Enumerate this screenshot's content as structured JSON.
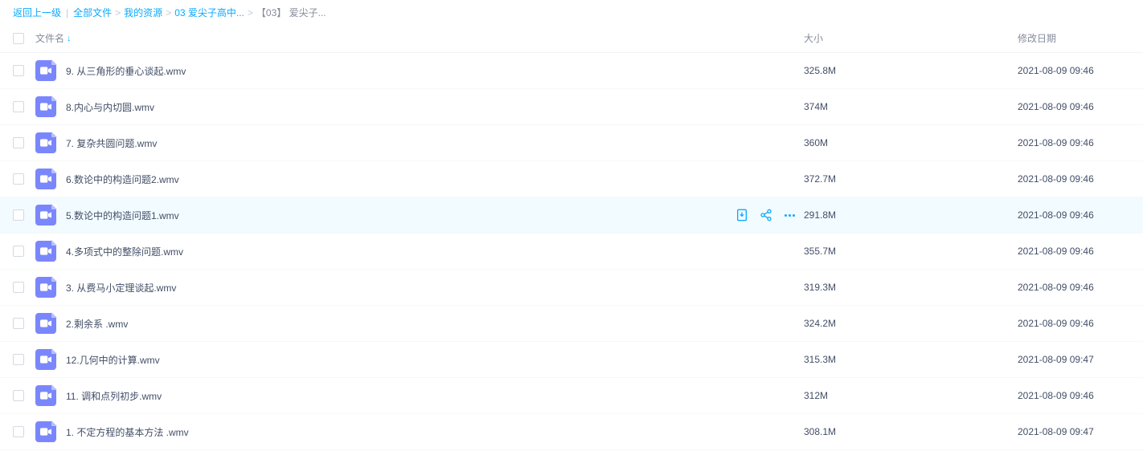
{
  "breadcrumb": {
    "back": "返回上一级",
    "items": [
      {
        "label": "全部文件",
        "link": true
      },
      {
        "label": "我的资源",
        "link": true
      },
      {
        "label": "03 爱尖子高中...",
        "link": true
      },
      {
        "label": "【03】 爱尖子...",
        "link": false
      }
    ]
  },
  "columns": {
    "name": "文件名",
    "size": "大小",
    "date": "修改日期"
  },
  "files": [
    {
      "name": "9. 从三角形的垂心谈起.wmv",
      "size": "325.8M",
      "date": "2021-08-09 09:46",
      "hover": false
    },
    {
      "name": "8.内心与内切圆.wmv",
      "size": "374M",
      "date": "2021-08-09 09:46",
      "hover": false
    },
    {
      "name": "7. 复杂共圆问题.wmv",
      "size": "360M",
      "date": "2021-08-09 09:46",
      "hover": false
    },
    {
      "name": "6.数论中的构造问题2.wmv",
      "size": "372.7M",
      "date": "2021-08-09 09:46",
      "hover": false
    },
    {
      "name": "5.数论中的构造问题1.wmv",
      "size": "291.8M",
      "date": "2021-08-09 09:46",
      "hover": true
    },
    {
      "name": "4.多项式中的整除问题.wmv",
      "size": "355.7M",
      "date": "2021-08-09 09:46",
      "hover": false
    },
    {
      "name": "3. 从费马小定理谈起.wmv",
      "size": "319.3M",
      "date": "2021-08-09 09:46",
      "hover": false
    },
    {
      "name": "2.剩余系 .wmv",
      "size": "324.2M",
      "date": "2021-08-09 09:46",
      "hover": false
    },
    {
      "name": "12.几何中的计算.wmv",
      "size": "315.3M",
      "date": "2021-08-09 09:47",
      "hover": false
    },
    {
      "name": "11. 调和点列初步.wmv",
      "size": "312M",
      "date": "2021-08-09 09:46",
      "hover": false
    },
    {
      "name": "1. 不定方程的基本方法 .wmv",
      "size": "308.1M",
      "date": "2021-08-09 09:47",
      "hover": false
    }
  ]
}
